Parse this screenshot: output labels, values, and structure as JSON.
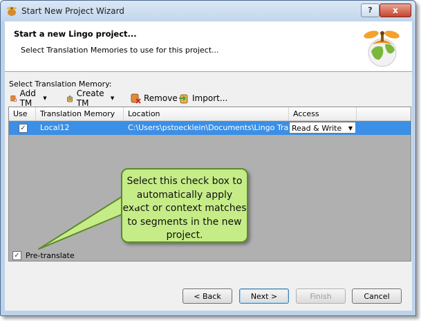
{
  "window": {
    "title": "Start New Project Wizard",
    "help_label": "?",
    "close_label": "x"
  },
  "header": {
    "heading": "Start a new Lingo project...",
    "subheading": "Select Translation Memories to use for this project..."
  },
  "tm_section": {
    "label": "Select Translation Memory:"
  },
  "toolbar": {
    "add_tm": "Add TM",
    "create_tm": "Create TM",
    "remove": "Remove",
    "import": "Import..."
  },
  "grid": {
    "columns": [
      "Use",
      "Translation Memory",
      "Location",
      "Access"
    ],
    "rows": [
      {
        "use": true,
        "tm": "Local12",
        "location": "C:\\Users\\pstoecklein\\Documents\\Lingo Transl...",
        "access": "Read & Write"
      }
    ]
  },
  "callout": {
    "text": "Select this check box to automatically apply exact or context matches to segments in the new project."
  },
  "pretranslate": {
    "checked": true,
    "label": "Pre-translate"
  },
  "buttons": {
    "back": "< Back",
    "next": "Next >",
    "finish": "Finish",
    "cancel": "Cancel"
  },
  "colors": {
    "selection": "#3b8fe6",
    "callout_fill": "#c6ec88",
    "callout_border": "#5c8a2c"
  }
}
